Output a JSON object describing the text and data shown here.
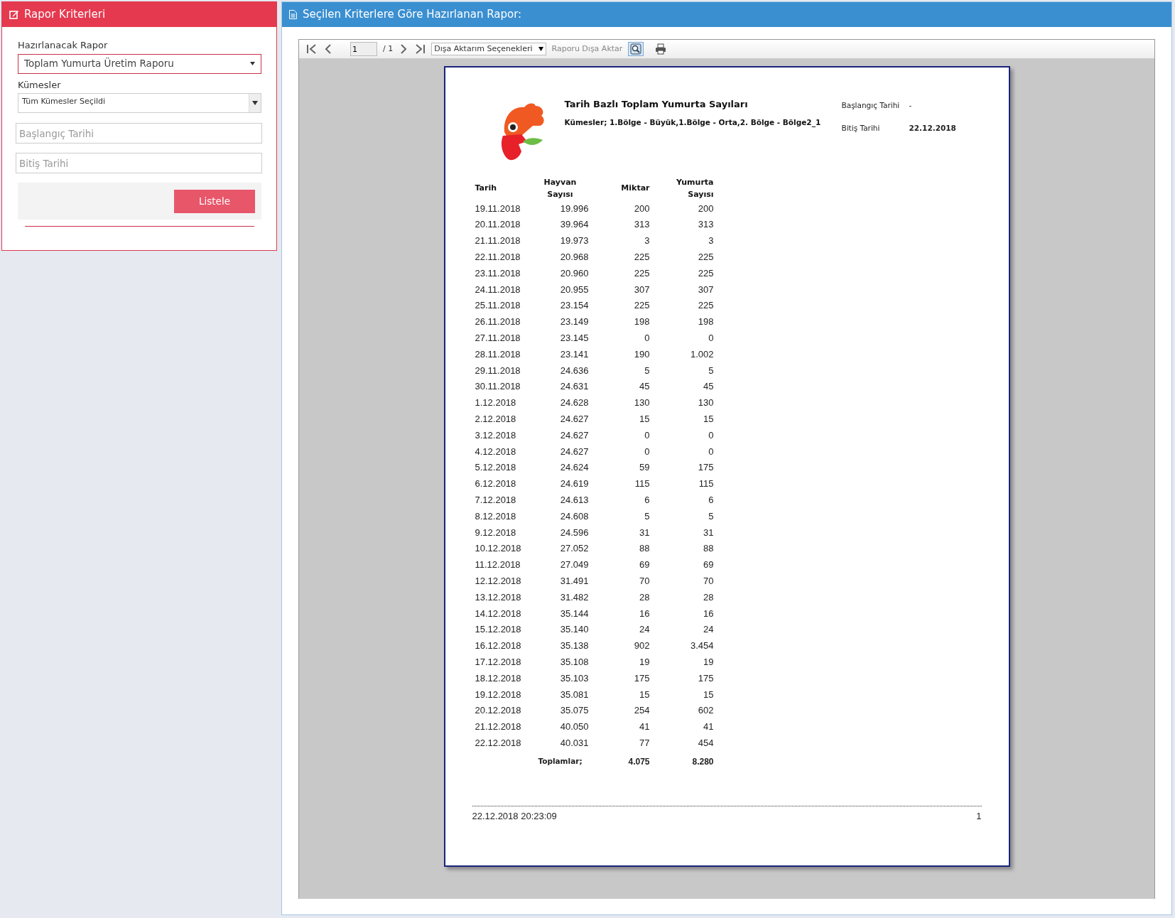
{
  "criteria_panel": {
    "title": "Rapor Kriterleri",
    "report_label": "Hazırlanacak Rapor",
    "report_value": "Toplam Yumurta Üretim Raporu",
    "coops_label": "Kümesler",
    "coops_value": "Tüm Kümesler Seçildi",
    "start_placeholder": "Başlangıç Tarihi",
    "end_placeholder": "Bitiş Tarihi",
    "list_button": "Listele"
  },
  "report_panel": {
    "title": "Seçilen Kriterlere Göre Hazırlanan Rapor:"
  },
  "toolbar": {
    "page": "1",
    "page_count": "/ 1",
    "export_options": "Dışa Aktarım Seçenekleri",
    "export_button": "Raporu Dışa Aktar"
  },
  "report": {
    "title": "Tarih Bazlı Toplam Yumurta Sayıları",
    "subtitle": "Kümesler; 1.Bölge - Büyük,1.Bölge - Orta,2. Bölge - Bölge2_1",
    "meta": [
      {
        "label": "Başlangıç Tarihi",
        "value": "-"
      },
      {
        "label": "Bitiş Tarihi",
        "value": "22.12.2018"
      }
    ],
    "columns": [
      "Tarih",
      "Hayvan Sayısı",
      "Miktar",
      "Yumurta Sayısı"
    ],
    "rows": [
      [
        "19.11.2018",
        "19.996",
        "200",
        "200"
      ],
      [
        "20.11.2018",
        "39.964",
        "313",
        "313"
      ],
      [
        "21.11.2018",
        "19.973",
        "3",
        "3"
      ],
      [
        "22.11.2018",
        "20.968",
        "225",
        "225"
      ],
      [
        "23.11.2018",
        "20.960",
        "225",
        "225"
      ],
      [
        "24.11.2018",
        "20.955",
        "307",
        "307"
      ],
      [
        "25.11.2018",
        "23.154",
        "225",
        "225"
      ],
      [
        "26.11.2018",
        "23.149",
        "198",
        "198"
      ],
      [
        "27.11.2018",
        "23.145",
        "0",
        "0"
      ],
      [
        "28.11.2018",
        "23.141",
        "190",
        "1.002"
      ],
      [
        "29.11.2018",
        "24.636",
        "5",
        "5"
      ],
      [
        "30.11.2018",
        "24.631",
        "45",
        "45"
      ],
      [
        "1.12.2018",
        "24.628",
        "130",
        "130"
      ],
      [
        "2.12.2018",
        "24.627",
        "15",
        "15"
      ],
      [
        "3.12.2018",
        "24.627",
        "0",
        "0"
      ],
      [
        "4.12.2018",
        "24.627",
        "0",
        "0"
      ],
      [
        "5.12.2018",
        "24.624",
        "59",
        "175"
      ],
      [
        "6.12.2018",
        "24.619",
        "115",
        "115"
      ],
      [
        "7.12.2018",
        "24.613",
        "6",
        "6"
      ],
      [
        "8.12.2018",
        "24.608",
        "5",
        "5"
      ],
      [
        "9.12.2018",
        "24.596",
        "31",
        "31"
      ],
      [
        "10.12.2018",
        "27.052",
        "88",
        "88"
      ],
      [
        "11.12.2018",
        "27.049",
        "69",
        "69"
      ],
      [
        "12.12.2018",
        "31.491",
        "70",
        "70"
      ],
      [
        "13.12.2018",
        "31.482",
        "28",
        "28"
      ],
      [
        "14.12.2018",
        "35.144",
        "16",
        "16"
      ],
      [
        "15.12.2018",
        "35.140",
        "24",
        "24"
      ],
      [
        "16.12.2018",
        "35.138",
        "902",
        "3.454"
      ],
      [
        "17.12.2018",
        "35.108",
        "19",
        "19"
      ],
      [
        "18.12.2018",
        "35.103",
        "175",
        "175"
      ],
      [
        "19.12.2018",
        "35.081",
        "15",
        "15"
      ],
      [
        "20.12.2018",
        "35.075",
        "254",
        "602"
      ],
      [
        "21.12.2018",
        "40.050",
        "41",
        "41"
      ],
      [
        "22.12.2018",
        "40.031",
        "77",
        "454"
      ]
    ],
    "totals": {
      "label": "Toplamlar;",
      "values": [
        "4.075",
        "8.280"
      ]
    },
    "footer": {
      "timestamp": "22.12.2018 20:23:09",
      "page_number": "1"
    }
  }
}
